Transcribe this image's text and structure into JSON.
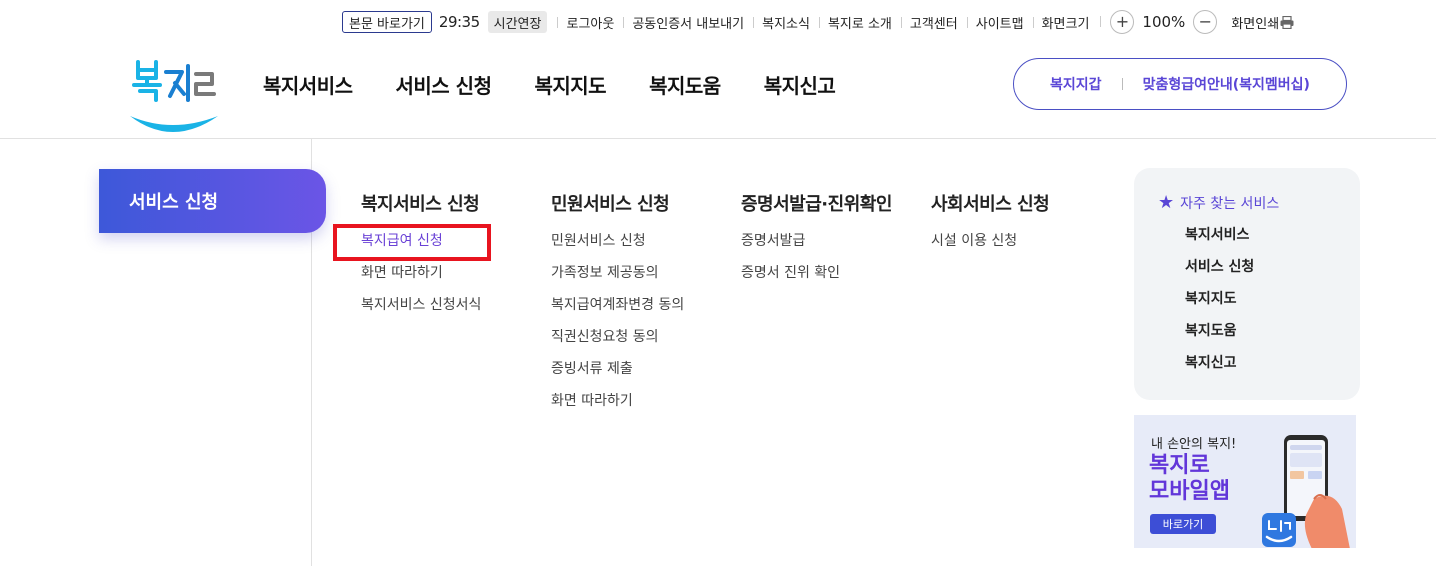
{
  "util": {
    "skip": "본문 바로가기",
    "timer": "29:35",
    "extend": "시간연장",
    "links": [
      "로그아웃",
      "공동인증서 내보내기",
      "복지소식",
      "복지로 소개",
      "고객센터",
      "사이트맵",
      "화면크기"
    ],
    "zoom_in": "+",
    "zoom_value": "100%",
    "zoom_out": "−",
    "print": "화면인쇄"
  },
  "logo": {
    "text": "복지로"
  },
  "gnb": [
    "복지서비스",
    "서비스 신청",
    "복지지도",
    "복지도움",
    "복지신고"
  ],
  "quick": {
    "wallet": "복지지갑",
    "membership": "맞춤형급여안내(복지멤버십)"
  },
  "side": {
    "title": "서비스 신청"
  },
  "columns": [
    {
      "head": "복지서비스 신청",
      "items": [
        "복지급여 신청",
        "화면 따라하기",
        "복지서비스 신청서식"
      ]
    },
    {
      "head": "민원서비스 신청",
      "items": [
        "민원서비스 신청",
        "가족정보 제공동의",
        "복지급여계좌변경 동의",
        "직권신청요청 동의",
        "증빙서류 제출",
        "화면 따라하기"
      ]
    },
    {
      "head": "증명서발급·진위확인",
      "items": [
        "증명서발급",
        "증명서 진위 확인"
      ]
    },
    {
      "head": "사회서비스 신청",
      "items": [
        "시설 이용 신청"
      ]
    }
  ],
  "favorites": {
    "head": "자주 찾는 서비스",
    "items": [
      "복지서비스",
      "서비스 신청",
      "복지지도",
      "복지도움",
      "복지신고"
    ]
  },
  "banner": {
    "sub": "내 손안의 복지!",
    "title_line1": "복지로",
    "title_line2": "모바일앱",
    "button": "바로가기"
  },
  "colors": {
    "accent": "#5a46d6",
    "highlight": "#e8141f",
    "logo_blue": "#1ab3e6"
  }
}
